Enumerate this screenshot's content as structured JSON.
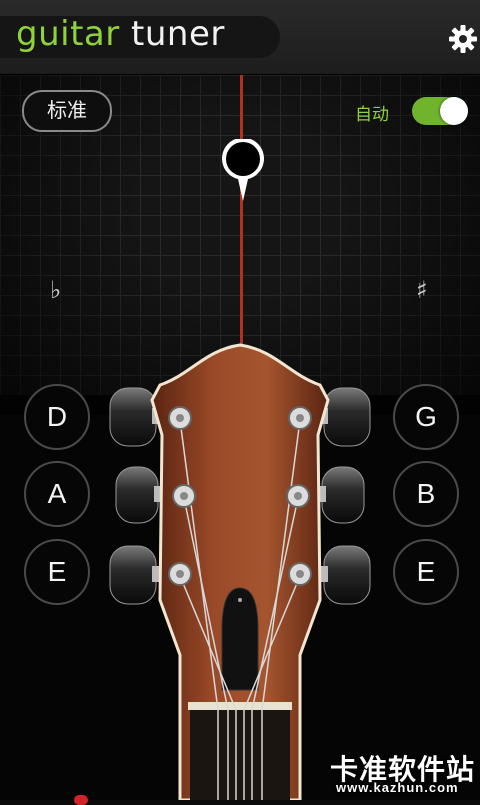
{
  "header": {
    "title_word1": "guitar",
    "title_word2": "tuner",
    "settings_icon": "gear-icon"
  },
  "tuner": {
    "tuning_mode": "标准",
    "auto_label": "自动",
    "auto_enabled": true,
    "flat_symbol": "♭",
    "sharp_symbol": "♯"
  },
  "strings": {
    "left": [
      "D",
      "A",
      "E"
    ],
    "right": [
      "G",
      "B",
      "E"
    ]
  },
  "watermark": {
    "brand": "卡准软件站",
    "url": "www.kazhun.com"
  },
  "colors": {
    "accent_green": "#8fd23a",
    "needle_red": "#b2321f",
    "wood_brown": "#8a3f22"
  }
}
